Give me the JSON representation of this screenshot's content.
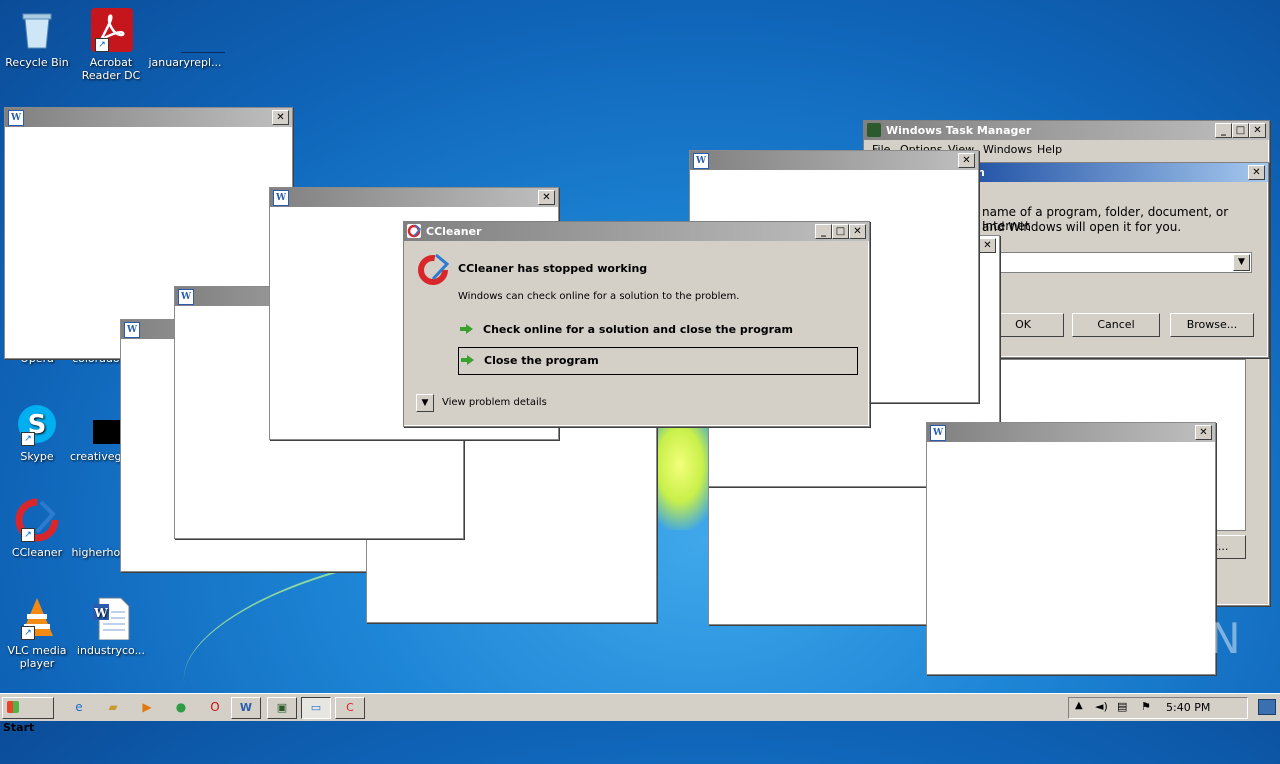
{
  "desktop_icons": [
    {
      "label": "Recycle Bin",
      "icon": "recycle-bin-icon"
    },
    {
      "label": "Acrobat Reader DC",
      "icon": "acrobat-icon"
    },
    {
      "label": "januaryrepl...",
      "icon": "document-icon"
    },
    {
      "label": "Opera",
      "icon": "opera-icon"
    },
    {
      "label": "colorado...",
      "icon": "document-icon"
    },
    {
      "label": "Skype",
      "icon": "skype-icon"
    },
    {
      "label": "creativeg...",
      "icon": "document-icon"
    },
    {
      "label": "CCleaner",
      "icon": "ccleaner-icon"
    },
    {
      "label": "higherho...",
      "icon": "document-icon"
    },
    {
      "label": "VLC media player",
      "icon": "vlc-icon"
    },
    {
      "label": "industryco...",
      "icon": "word-doc-icon"
    }
  ],
  "task_manager": {
    "title": "Windows Task Manager",
    "menu": [
      "File",
      "Options",
      "View",
      "Windows",
      "Help"
    ]
  },
  "run_dialog": {
    "title_fragment": "n",
    "desc_line1": "name of a program, folder, document, or Internet",
    "desc_line2": "and Windows will open it for you.",
    "ok": "OK",
    "cancel": "Cancel",
    "browse": "Browse...",
    "behind_button": "k..."
  },
  "ccleaner_dialog": {
    "title": "CCleaner",
    "heading": "CCleaner has stopped working",
    "message": "Windows can check online for a solution to the problem.",
    "option1": "Check online for a solution and close the program",
    "option2": "Close the program",
    "details": "View problem details"
  },
  "taskbar": {
    "start_label": "Start",
    "clock": "5:40 PM"
  },
  "watermark": "ANY RUN"
}
